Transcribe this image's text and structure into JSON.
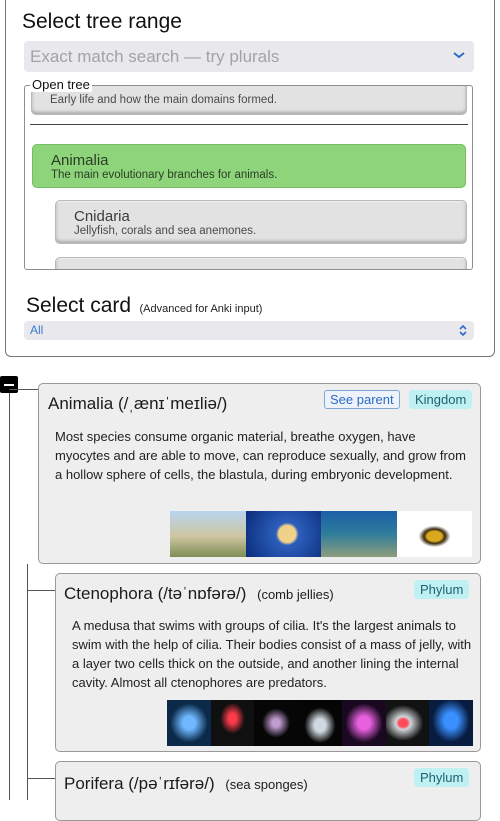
{
  "header": {
    "title": "Select tree range",
    "search_placeholder": "Exact match search — try plurals"
  },
  "tree": {
    "legend": "Open tree",
    "nodes": [
      {
        "name": "",
        "desc": "Early life and how the main domains formed."
      },
      {
        "name": "Animalia",
        "desc": "The main evolutionary branches for animals."
      },
      {
        "name": "Cnidaria",
        "desc": "Jellyfish, corals and sea anemones."
      }
    ]
  },
  "card_select": {
    "title": "Select card",
    "subtitle": "(Advanced for Anki input)",
    "value": "All"
  },
  "cards": [
    {
      "name": "Animalia",
      "pron": "(/ˌænɪˈmeɪliə/)",
      "common": "",
      "rank": "Kingdom",
      "see_parent": "See parent",
      "text": "Most species consume organic material, breathe oxygen, have myocytes and are able to move, can reproduce sexually, and grow from a hollow sphere of cells, the blastula, during embryonic development."
    },
    {
      "name": "Ctenophora",
      "pron": "(/təˈnɒfərə/)",
      "common": "(comb jellies)",
      "rank": "Phylum",
      "text": "A medusa that swims with groups of cilia. It's the largest animals to swim with the help of cilia. Their bodies consist of a mass of jelly, with a layer two cells thick on the outside, and another lining the internal cavity. Almost all ctenophores are predators."
    },
    {
      "name": "Porifera",
      "pron": "(/pəˈrɪfərə/)",
      "common": "(sea sponges)",
      "rank": "Phylum"
    }
  ],
  "colors": {
    "selected_node": "#8ed47b",
    "rank_badge": "#bff0f2",
    "link": "#3a7bd5"
  }
}
